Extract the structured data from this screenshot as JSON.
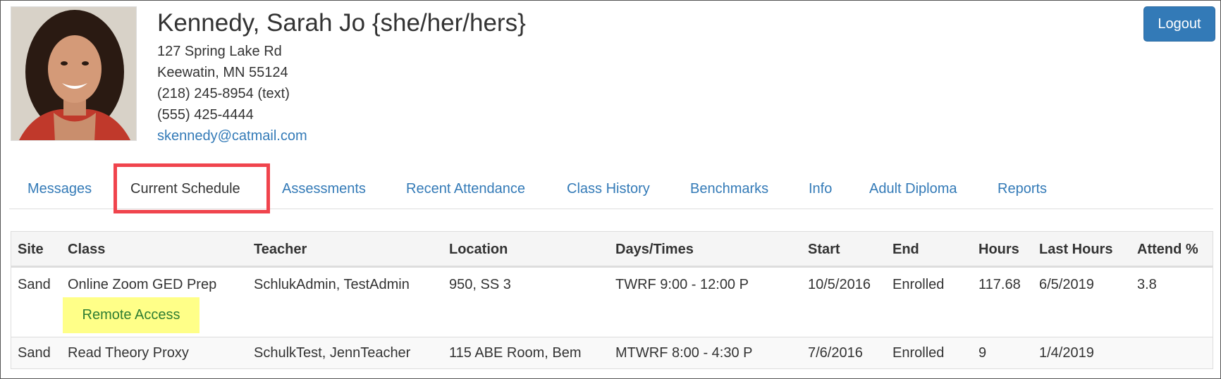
{
  "profile": {
    "name": "Kennedy, Sarah Jo {she/her/hers}",
    "address_line1": "127 Spring Lake Rd",
    "address_line2": "Keewatin, MN 55124",
    "phone1": "(218) 245-8954 (text)",
    "phone2": "(555) 425-4444",
    "email": "skennedy@catmail.com"
  },
  "header": {
    "logout_label": "Logout"
  },
  "tabs": [
    {
      "label": "Messages"
    },
    {
      "label": "Current Schedule"
    },
    {
      "label": "Assessments"
    },
    {
      "label": "Recent Attendance"
    },
    {
      "label": "Class History"
    },
    {
      "label": "Benchmarks"
    },
    {
      "label": "Info"
    },
    {
      "label": "Adult Diploma"
    },
    {
      "label": "Reports"
    }
  ],
  "schedule": {
    "columns": [
      "Site",
      "Class",
      "Teacher",
      "Location",
      "Days/Times",
      "Start",
      "End",
      "Hours",
      "Last Hours",
      "Attend %"
    ],
    "rows": [
      {
        "site": "Sand",
        "class": "Online Zoom GED Prep",
        "teacher": "SchlukAdmin, TestAdmin",
        "location": "950, SS 3",
        "days_times": "TWRF 9:00 - 12:00 P",
        "start": "10/5/2016",
        "end": "Enrolled",
        "hours": "117.68",
        "last_hours": "6/5/2019",
        "attend": "3.8",
        "remote_label": "Remote Access"
      },
      {
        "site": "Sand",
        "class": "Read Theory Proxy",
        "teacher": "SchulkTest, JennTeacher",
        "location": "115 ABE Room, Bem",
        "days_times": "MTWRF 8:00 - 4:30 P",
        "start": "7/6/2016",
        "end": "Enrolled",
        "hours": "9",
        "last_hours": "1/4/2019",
        "attend": ""
      }
    ]
  },
  "colors": {
    "link": "#337ab7",
    "button": "#337ab7",
    "highlight_box": "#f0444d",
    "remote_highlight": "#ffff88"
  }
}
